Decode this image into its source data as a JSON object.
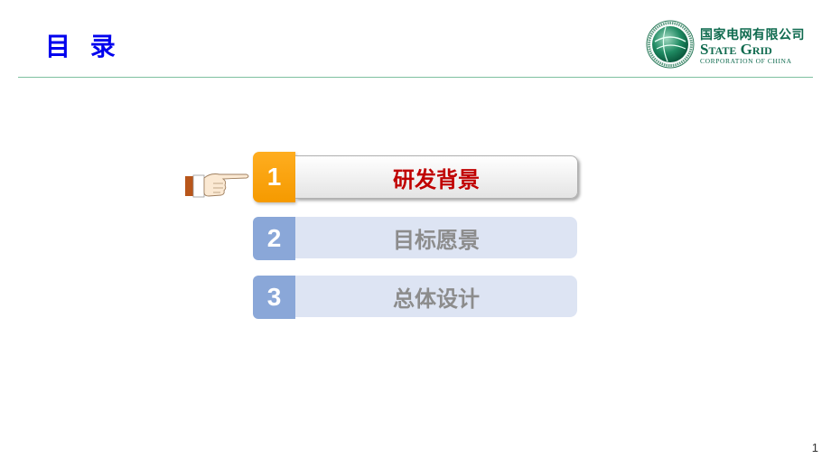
{
  "header": {
    "title": "目 录",
    "rule_color": "#7fc0a0"
  },
  "logo": {
    "name_cn": "国家电网有限公司",
    "name_en": "State Grid",
    "subtitle": "CORPORATION OF CHINA",
    "icon": "state-grid-globe-icon"
  },
  "pointer": {
    "icon": "pointing-hand-icon"
  },
  "toc": {
    "active_index": 0,
    "items": [
      {
        "number": "1",
        "label": "研发背景",
        "state": "active"
      },
      {
        "number": "2",
        "label": "目标愿景",
        "state": "inactive"
      },
      {
        "number": "3",
        "label": "总体设计",
        "state": "inactive"
      }
    ],
    "colors": {
      "active_number_bg": "#f59a00",
      "active_text": "#c00000",
      "inactive_number_bg": "#8aa7d8",
      "inactive_bar_bg": "#dde4f3",
      "inactive_text": "#8c8c8c"
    }
  },
  "footer": {
    "page_number": "1"
  }
}
